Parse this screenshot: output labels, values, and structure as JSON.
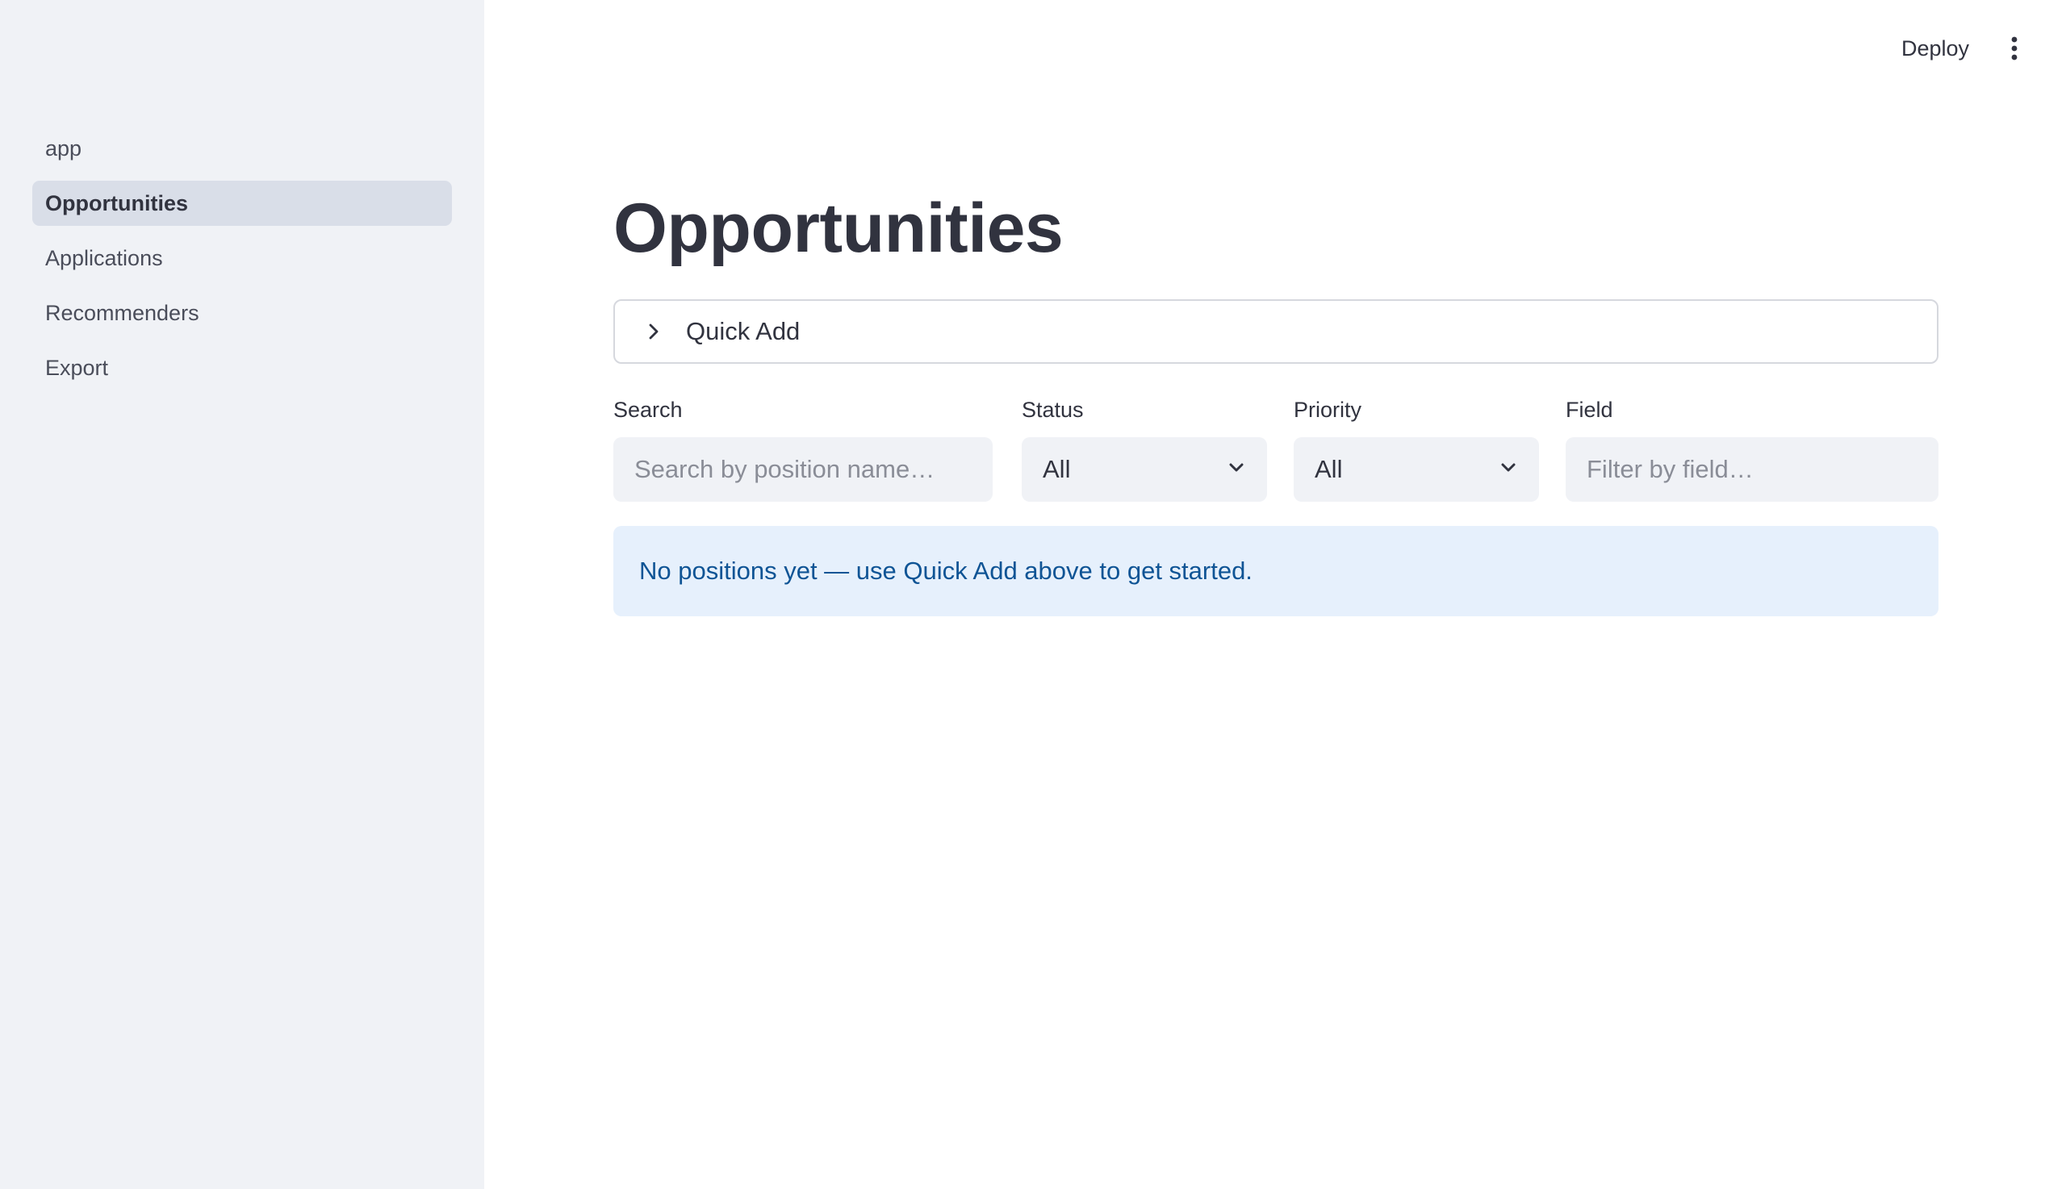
{
  "sidebar": {
    "items": [
      {
        "label": "app",
        "active": false
      },
      {
        "label": "Opportunities",
        "active": true
      },
      {
        "label": "Applications",
        "active": false
      },
      {
        "label": "Recommenders",
        "active": false
      },
      {
        "label": "Export",
        "active": false
      }
    ]
  },
  "header": {
    "deploy_label": "Deploy",
    "menu_icon": "vertical-ellipsis-icon"
  },
  "main": {
    "title": "Opportunities",
    "expander": {
      "label": "Quick Add",
      "icon": "chevron-right-icon",
      "expanded": false
    },
    "filters": {
      "search": {
        "label": "Search",
        "placeholder": "Search by position name…",
        "value": ""
      },
      "status": {
        "label": "Status",
        "value": "All"
      },
      "priority": {
        "label": "Priority",
        "value": "All"
      },
      "field": {
        "label": "Field",
        "placeholder": "Filter by field…",
        "value": ""
      }
    },
    "info_message": "No positions yet — use Quick Add above to get started."
  },
  "colors": {
    "sidebar_bg": "#f0f2f6",
    "active_nav_bg": "#d9dee8",
    "info_bg": "#e6f0fc",
    "info_text": "#0f5495",
    "text": "#31333f"
  }
}
